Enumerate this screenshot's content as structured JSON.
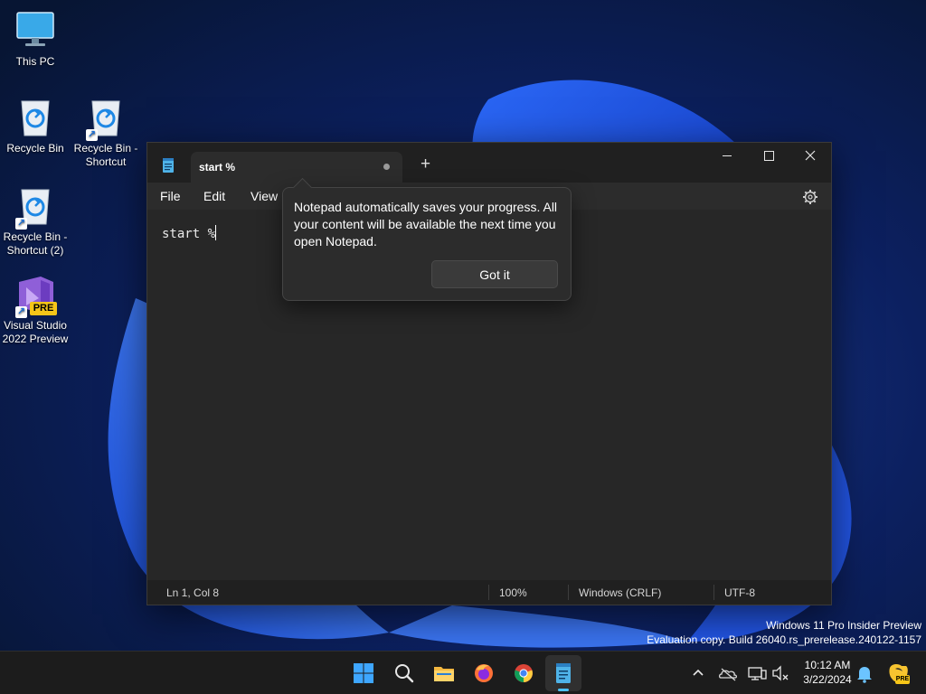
{
  "desktop": {
    "icons": [
      {
        "label": "This PC"
      },
      {
        "label": "Recycle Bin"
      },
      {
        "label": "Recycle Bin - Shortcut"
      },
      {
        "label": "Recycle Bin - Shortcut (2)"
      },
      {
        "label": "Visual Studio 2022 Preview",
        "badge": "PRE"
      }
    ],
    "watermark": {
      "line1": "Windows 11 Pro Insider Preview",
      "line2": "Evaluation copy. Build 26040.rs_prerelease.240122-1157"
    }
  },
  "notepad": {
    "tab_title": "start %",
    "new_tab_icon": "plus-icon",
    "window_controls": [
      "minimize-icon",
      "maximize-icon",
      "close-icon"
    ],
    "menu": {
      "file": "File",
      "edit": "Edit",
      "view": "View"
    },
    "settings_icon": "gear-icon",
    "content": "start %",
    "status": {
      "position": "Ln 1, Col 8",
      "zoom": "100%",
      "line_ending": "Windows (CRLF)",
      "encoding": "UTF-8"
    },
    "popup": {
      "message": "Notepad automatically saves your progress. All your content will be available the next time you open Notepad.",
      "button": "Got it"
    }
  },
  "taskbar": {
    "apps": [
      "start-icon",
      "search-icon",
      "file-explorer-icon",
      "firefox-icon",
      "chrome-icon",
      "notepad-icon"
    ],
    "tray_icons": [
      "chevron-up-icon",
      "onedrive-icon",
      "network-icon",
      "volume-icon",
      "notification-bell-icon",
      "copilot-icon"
    ],
    "copilot_badge": "PRE",
    "time": "10:12 AM",
    "date": "3/22/2024"
  },
  "colors": {
    "accent": "#4cc2ff",
    "window_bg": "#272727",
    "taskbar_bg": "#1c1c1c"
  }
}
